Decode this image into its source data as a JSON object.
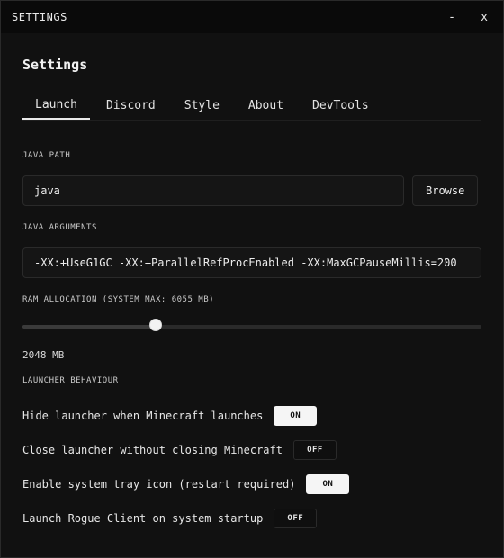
{
  "window": {
    "title": "SETTINGS",
    "minimize_label": "-",
    "close_label": "x"
  },
  "page": {
    "heading": "Settings"
  },
  "tabs": [
    {
      "label": "Launch",
      "active": true
    },
    {
      "label": "Discord",
      "active": false
    },
    {
      "label": "Style",
      "active": false
    },
    {
      "label": "About",
      "active": false
    },
    {
      "label": "DevTools",
      "active": false
    }
  ],
  "java_path": {
    "label": "JAVA PATH",
    "value": "java",
    "browse_label": "Browse"
  },
  "java_arguments": {
    "label": "JAVA ARGUMENTS",
    "value": "-XX:+UseG1GC -XX:+ParallelRefProcEnabled -XX:MaxGCPauseMillis=200"
  },
  "ram": {
    "label": "RAM ALLOCATION (SYSTEM MAX: 6055 MB)",
    "value_text": "2048 MB",
    "fraction": 0.29
  },
  "launcher": {
    "label": "LAUNCHER BEHAVIOUR",
    "items": [
      {
        "label": "Hide launcher when Minecraft launches",
        "state": "ON"
      },
      {
        "label": "Close launcher without closing Minecraft",
        "state": "OFF"
      },
      {
        "label": "Enable system tray icon (restart required)",
        "state": "ON"
      },
      {
        "label": "Launch Rogue Client on system startup",
        "state": "OFF"
      }
    ]
  },
  "colors": {
    "background": "#111111",
    "titlebar": "#0a0a0a",
    "toggle_on": "#f5f5f5",
    "toggle_off": "#0f0f0f"
  }
}
